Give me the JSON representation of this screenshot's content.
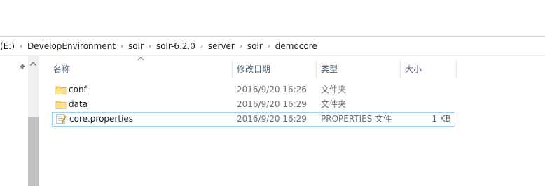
{
  "breadcrumb": {
    "items": [
      {
        "label": "(E:)"
      },
      {
        "label": "DevelopEnvironment"
      },
      {
        "label": "solr"
      },
      {
        "label": "solr-6.2.0"
      },
      {
        "label": "server"
      },
      {
        "label": "solr"
      },
      {
        "label": "democore"
      }
    ],
    "separator": "›"
  },
  "columns": {
    "name": "名称",
    "modified": "修改日期",
    "type": "类型",
    "size": "大小"
  },
  "files": [
    {
      "name": "conf",
      "modified": "2016/9/20 16:26",
      "type": "文件夹",
      "size": "",
      "icon": "folder-icon"
    },
    {
      "name": "data",
      "modified": "2016/9/20 16:29",
      "type": "文件夹",
      "size": "",
      "icon": "folder-icon"
    },
    {
      "name": "core.properties",
      "modified": "2016/9/20 16:29",
      "type": "PROPERTIES 文件",
      "size": "1 KB",
      "icon": "properties-file-icon",
      "selected": true
    }
  ],
  "colors": {
    "selection_border": "#99d1ff",
    "header_text": "#4c607a",
    "folder_yellow": "#f8d775"
  }
}
